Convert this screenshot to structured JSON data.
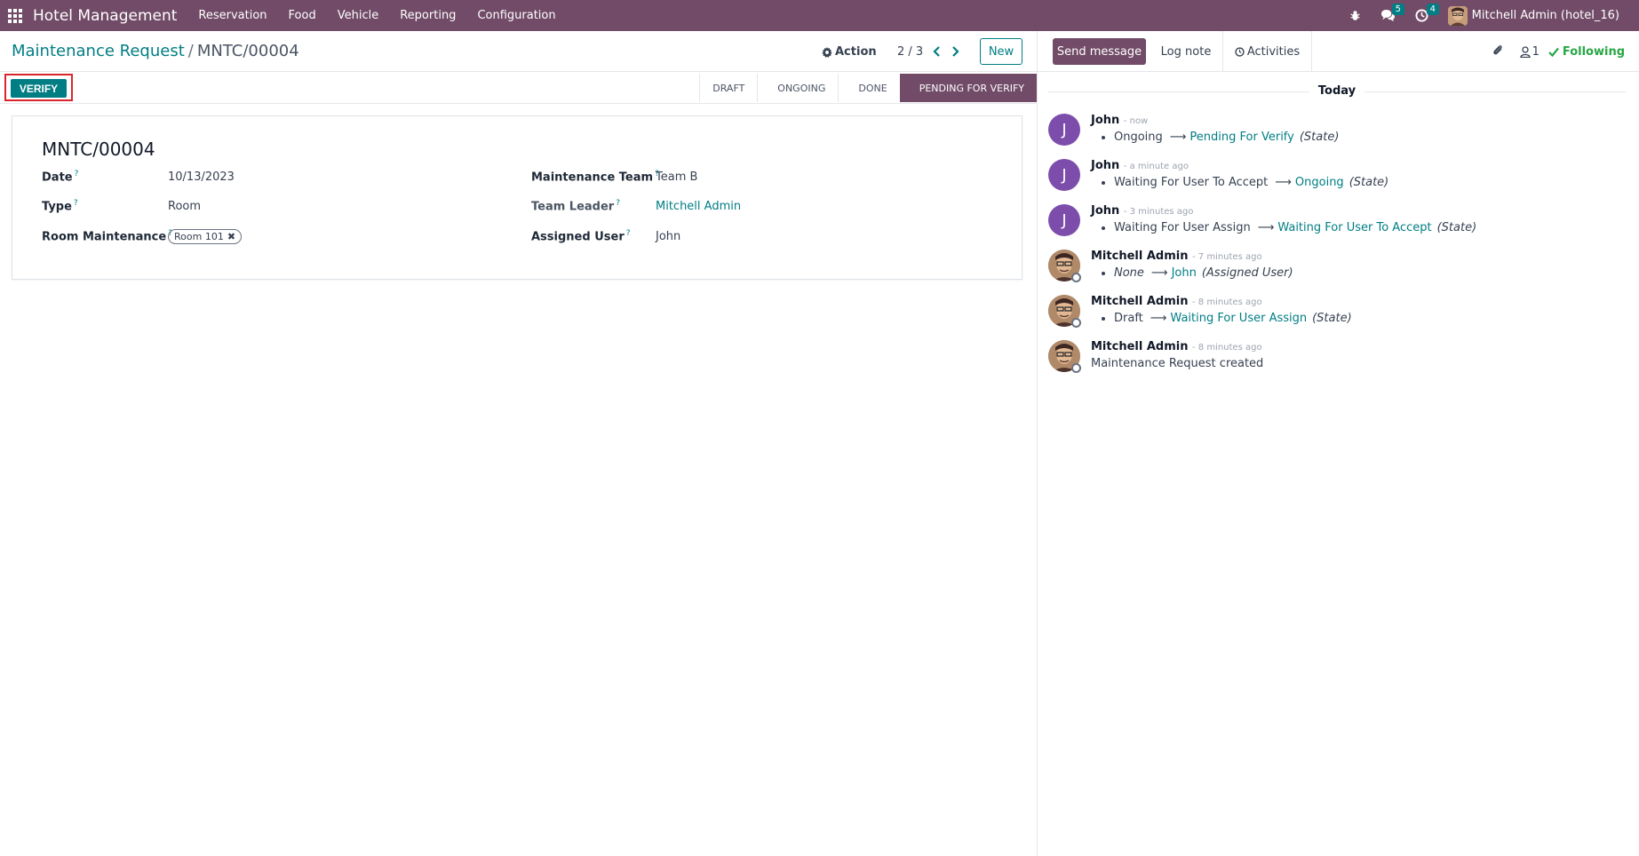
{
  "navbar": {
    "brand": "Hotel Management",
    "menu": [
      "Reservation",
      "Food",
      "Vehicle",
      "Reporting",
      "Configuration"
    ],
    "messages_badge": "5",
    "activities_badge": "4",
    "user_name": "Mitchell Admin (hotel_16)"
  },
  "control_panel": {
    "breadcrumb_parent": "Maintenance Request",
    "breadcrumb_separator": "/",
    "breadcrumb_current": "MNTC/00004",
    "action_label": "Action",
    "pager": "2 / 3",
    "new_label": "New"
  },
  "statusbar": {
    "verify_label": "VERIFY",
    "stages": [
      "DRAFT",
      "ONGOING",
      "DONE",
      "PENDING FOR VERIFY"
    ],
    "active_stage": "PENDING FOR VERIFY"
  },
  "form": {
    "title": "MNTC/00004",
    "left_fields": [
      {
        "label": "Date",
        "value": "10/13/2023"
      },
      {
        "label": "Type",
        "value": "Room"
      },
      {
        "label": "Room Maintenance",
        "tag": "Room 101"
      }
    ],
    "right_fields": [
      {
        "label": "Maintenance Team",
        "value": "Team B"
      },
      {
        "label": "Team Leader",
        "value": "Mitchell Admin"
      },
      {
        "label": "Assigned User",
        "value": "John"
      }
    ],
    "help_mark": "?"
  },
  "chatter": {
    "send_message": "Send message",
    "log_note": "Log note",
    "activities": "Activities",
    "followers_count": "1",
    "following": "Following",
    "date_separator": "Today",
    "messages": [
      {
        "author": "John",
        "time": "- now",
        "initial": "J",
        "old": "Ongoing",
        "new": "Pending For Verify",
        "field": "(State)"
      },
      {
        "author": "John",
        "time": "- a minute ago",
        "initial": "J",
        "old": "Waiting For User To Accept",
        "new": "Ongoing",
        "field": "(State)"
      },
      {
        "author": "John",
        "time": "- 3 minutes ago",
        "initial": "J",
        "old": "Waiting For User Assign",
        "new": "Waiting For User To Accept",
        "field": "(State)"
      },
      {
        "author": "Mitchell Admin",
        "time": "- 7 minutes ago",
        "old": "None",
        "new": "John",
        "field": "(Assigned User)"
      },
      {
        "author": "Mitchell Admin",
        "time": "- 8 minutes ago",
        "old": "Draft",
        "new": "Waiting For User Assign",
        "field": "(State)"
      },
      {
        "author": "Mitchell Admin",
        "time": "- 8 minutes ago",
        "text": "Maintenance Request created"
      }
    ]
  },
  "colors": {
    "brand": "#714b67",
    "accent": "#017e84",
    "following": "#28a745",
    "highlight_border": "#d9262a"
  }
}
